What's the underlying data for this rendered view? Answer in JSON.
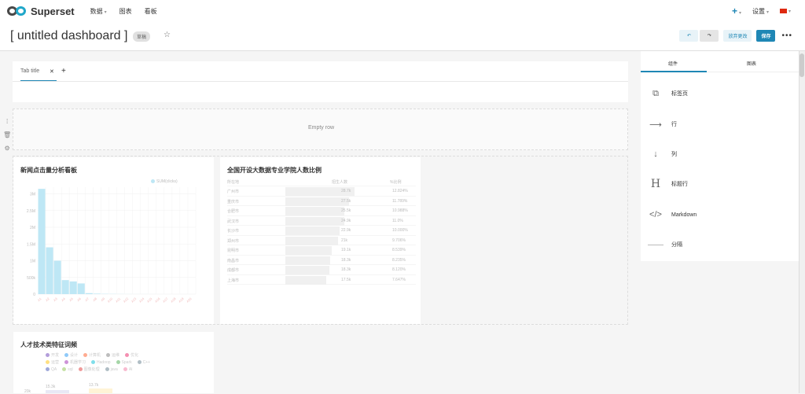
{
  "nav": {
    "logo": "Superset",
    "menu": [
      "数据",
      "图表",
      "看板"
    ],
    "settings": "设置"
  },
  "header": {
    "title": "[ untitled dashboard ]",
    "badge": "草稿",
    "discard": "放弃更改",
    "save": "保存"
  },
  "tabs": {
    "title": "Tab title"
  },
  "empty_row": "Empty row",
  "chart1": {
    "title": "新闻点击量分析看板",
    "legend": "SUM(clicks)"
  },
  "chart2": {
    "title": "全国开设大数据专业学院人数比例",
    "headers": [
      "所在地",
      "招生人数",
      "%比例"
    ],
    "rows": [
      [
        "广州市",
        "28.7k",
        "12.824%"
      ],
      [
        "重庆市",
        "27.5k",
        "11.789%"
      ],
      [
        "合肥市",
        "25.5k",
        "10.988%"
      ],
      [
        "武汉市",
        "24.9k",
        "11.0%"
      ],
      [
        "长沙市",
        "22.9k",
        "10.000%"
      ],
      [
        "郑州市",
        "21k",
        "9.706%"
      ],
      [
        "昆明市",
        "19.1k",
        "8.539%"
      ],
      [
        "南昌市",
        "18.3k",
        "8.235%"
      ],
      [
        "成都市",
        "18.3k",
        "8.120%"
      ],
      [
        "上海市",
        "17.5k",
        "7.647%"
      ]
    ]
  },
  "chart3": {
    "title": "人才技术类特征词频",
    "tags": [
      "开发",
      "设计",
      "计算机",
      "运维",
      "优化",
      "运营",
      "机器学习",
      "Hadoop",
      "Spark",
      "C++",
      "QA",
      "sql",
      "图像处理",
      "java",
      "AI"
    ],
    "tag_colors": [
      "#b39ddb",
      "#90caf9",
      "#ffab91",
      "#bdbdbd",
      "#f48fb1",
      "#ffe082",
      "#ce93d8",
      "#80deea",
      "#a5d6a7",
      "#b0bec5",
      "#9fa8da",
      "#c5e1a5",
      "#ef9a9a",
      "#b0bec5",
      "#f8bbd0"
    ],
    "values": [
      "15.3k",
      "13.7k"
    ],
    "yaxis_label": "20k"
  },
  "chart_data": {
    "type": "bar",
    "title": "新闻点击量分析看板",
    "legend": [
      "SUM(clicks)"
    ],
    "yticks": [
      "0",
      "500k",
      "1M",
      "1.5M",
      "2M",
      "2.5M",
      "3M"
    ],
    "ylim": [
      0,
      3200000
    ],
    "categories": [
      "A1",
      "A2",
      "A3",
      "A4",
      "A5",
      "A6",
      "A7",
      "A8",
      "A9",
      "A10",
      "A11",
      "A12",
      "A13",
      "A14",
      "A15",
      "A16",
      "A17",
      "A18",
      "A19",
      "A20"
    ],
    "values": [
      3150000,
      1400000,
      1000000,
      420000,
      380000,
      320000,
      30000,
      15000,
      8000,
      5000,
      3000,
      2000,
      1500,
      1000,
      800,
      600,
      500,
      400,
      300,
      200
    ],
    "color": "#bee7f5"
  },
  "panel": {
    "tabs": [
      "组件",
      "图表"
    ],
    "items": [
      "标签页",
      "行",
      "列",
      "标题行",
      "Markdown",
      "分隔"
    ]
  },
  "colors": {
    "accent": "#1f87b5"
  }
}
